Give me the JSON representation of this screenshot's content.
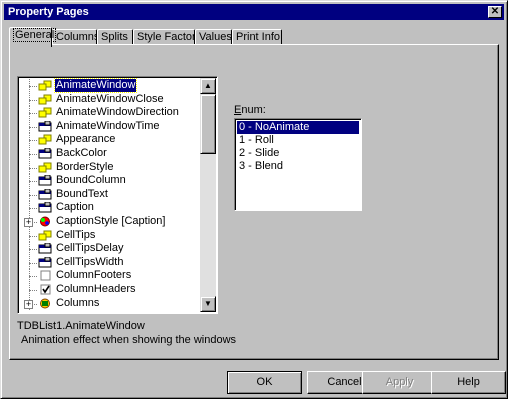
{
  "window": {
    "title": "Property Pages",
    "close_label": "✕"
  },
  "tabs": [
    {
      "label": "General",
      "active": true
    },
    {
      "label": "Columns",
      "active": false
    },
    {
      "label": "Splits",
      "active": false
    },
    {
      "label": "Style Factory",
      "active": false
    },
    {
      "label": "Values",
      "active": false
    },
    {
      "label": "Print Info",
      "active": false
    }
  ],
  "properties": [
    {
      "label": "AnimateWindow",
      "icon": "enum-property-icon",
      "selected": true
    },
    {
      "label": "AnimateWindowClose",
      "icon": "enum-property-icon"
    },
    {
      "label": "AnimateWindowDirection",
      "icon": "enum-property-icon"
    },
    {
      "label": "AnimateWindowTime",
      "icon": "value-property-icon"
    },
    {
      "label": "Appearance",
      "icon": "enum-property-icon"
    },
    {
      "label": "BackColor",
      "icon": "value-property-icon"
    },
    {
      "label": "BorderStyle",
      "icon": "enum-property-icon"
    },
    {
      "label": "BoundColumn",
      "icon": "value-property-icon"
    },
    {
      "label": "BoundText",
      "icon": "value-property-icon"
    },
    {
      "label": "Caption",
      "icon": "value-property-icon"
    },
    {
      "label": "CaptionStyle [Caption]",
      "icon": "style-object-icon",
      "expandable": true
    },
    {
      "label": "CellTips",
      "icon": "enum-property-icon"
    },
    {
      "label": "CellTipsDelay",
      "icon": "value-property-icon"
    },
    {
      "label": "CellTipsWidth",
      "icon": "value-property-icon"
    },
    {
      "label": "ColumnFooters",
      "icon": "checkbox-unchecked-icon"
    },
    {
      "label": "ColumnHeaders",
      "icon": "checkbox-checked-icon"
    },
    {
      "label": "Columns",
      "icon": "collection-object-icon",
      "expandable": true
    }
  ],
  "enum": {
    "label_prefix": "",
    "label_accel": "E",
    "label_rest": "num:",
    "items": [
      {
        "label": "0 - NoAnimate",
        "selected": true
      },
      {
        "label": "1 - Roll"
      },
      {
        "label": "2 - Slide"
      },
      {
        "label": "3 - Blend"
      }
    ]
  },
  "description": {
    "name": "TDBList1.AnimateWindow",
    "text": "Animation effect when showing the windows"
  },
  "buttons": {
    "ok": "OK",
    "cancel": "Cancel",
    "apply": "Apply",
    "help": "Help"
  }
}
